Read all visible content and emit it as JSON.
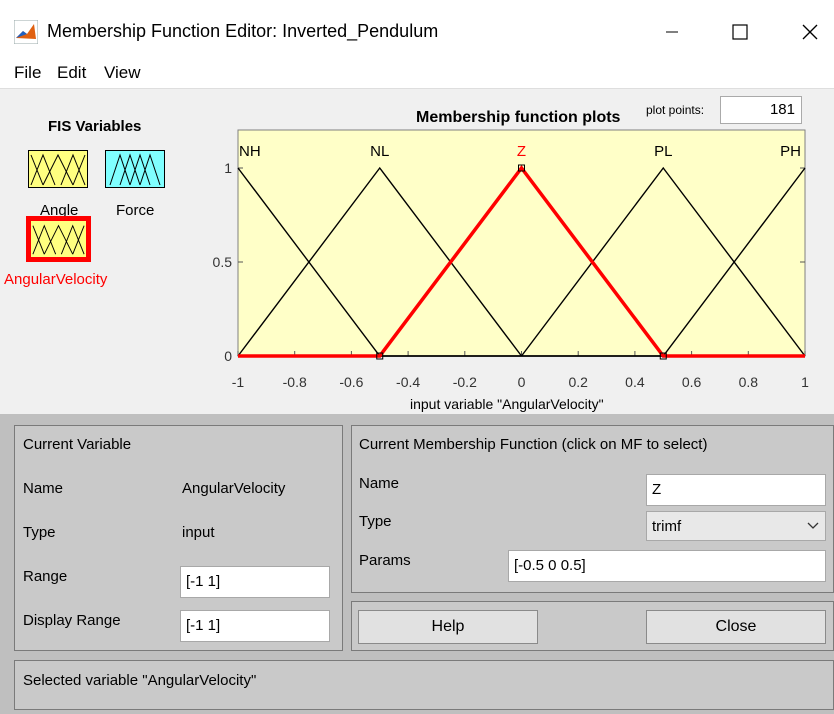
{
  "window": {
    "title": "Membership Function Editor: Inverted_Pendulum",
    "minimize_icon": "minimize-icon",
    "maximize_icon": "maximize-icon",
    "close_icon": "close-icon"
  },
  "menu": {
    "items": [
      "File",
      "Edit",
      "View"
    ]
  },
  "fis": {
    "title": "FIS Variables",
    "variables": [
      {
        "label": "Angle",
        "color": "#ffff80"
      },
      {
        "label": "Force",
        "color": "#80ffff"
      },
      {
        "label": "AngularVelocity",
        "color": "#ffff80",
        "selected": true
      }
    ]
  },
  "plot": {
    "title": "Membership function plots",
    "plot_points_label": "plot points:",
    "plot_points": "181",
    "xlabel": "input variable \"AngularVelocity\"",
    "background": "#ffffc8"
  },
  "chart_data": {
    "type": "line",
    "title": "Membership function plots",
    "xlabel": "input variable \"AngularVelocity\"",
    "ylabel": "",
    "xlim": [
      -1,
      1
    ],
    "ylim": [
      0,
      1
    ],
    "x_ticks": [
      "-1",
      "-0.8",
      "-0.6",
      "-0.4",
      "-0.2",
      "0",
      "0.2",
      "0.4",
      "0.6",
      "0.8",
      "1"
    ],
    "y_ticks": [
      "0",
      "0.5",
      "1"
    ],
    "series": [
      {
        "name": "NH",
        "points": [
          [
            -1,
            1
          ],
          [
            -0.5,
            0
          ],
          [
            1,
            0
          ]
        ],
        "selected": false
      },
      {
        "name": "NL",
        "points": [
          [
            -1,
            0
          ],
          [
            -0.5,
            1
          ],
          [
            0,
            0
          ]
        ],
        "selected": false
      },
      {
        "name": "Z",
        "points": [
          [
            -1,
            0
          ],
          [
            -0.5,
            0
          ],
          [
            0,
            1
          ],
          [
            0.5,
            0
          ],
          [
            1,
            0
          ]
        ],
        "selected": true
      },
      {
        "name": "PL",
        "points": [
          [
            0,
            0
          ],
          [
            0.5,
            1
          ],
          [
            1,
            0
          ]
        ],
        "selected": false
      },
      {
        "name": "PH",
        "points": [
          [
            -1,
            0
          ],
          [
            0.5,
            0
          ],
          [
            1,
            1
          ]
        ],
        "selected": false
      }
    ],
    "selected_color": "#ff0000",
    "line_color": "#000000"
  },
  "current_variable": {
    "title": "Current Variable",
    "name_label": "Name",
    "name_value": "AngularVelocity",
    "type_label": "Type",
    "type_value": "input",
    "range_label": "Range",
    "range_value": "[-1 1]",
    "display_range_label": "Display Range",
    "display_range_value": "[-1 1]"
  },
  "current_mf": {
    "title": "Current Membership Function (click on MF to select)",
    "name_label": "Name",
    "name_value": "Z",
    "type_label": "Type",
    "type_value": "trimf",
    "params_label": "Params",
    "params_value": "[-0.5 0 0.5]"
  },
  "buttons": {
    "help": "Help",
    "close": "Close"
  },
  "status": "Selected variable \"AngularVelocity\""
}
